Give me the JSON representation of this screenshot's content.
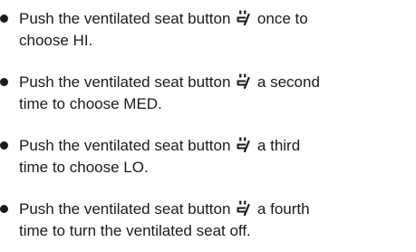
{
  "items": [
    {
      "pre": "Push the ventilated seat button",
      "icon": "ventilated-seat-icon",
      "post": "once to",
      "line2": "choose HI."
    },
    {
      "pre": "Push the ventilated seat button",
      "icon": "ventilated-seat-icon",
      "post": "a second",
      "line2": "time to choose MED."
    },
    {
      "pre": "Push the ventilated seat button",
      "icon": "ventilated-seat-icon",
      "post": "a third",
      "line2": "time to choose LO."
    },
    {
      "pre": "Push the ventilated seat button",
      "icon": "ventilated-seat-icon",
      "post": "a fourth",
      "line2": "time to turn the ventilated seat off."
    }
  ]
}
